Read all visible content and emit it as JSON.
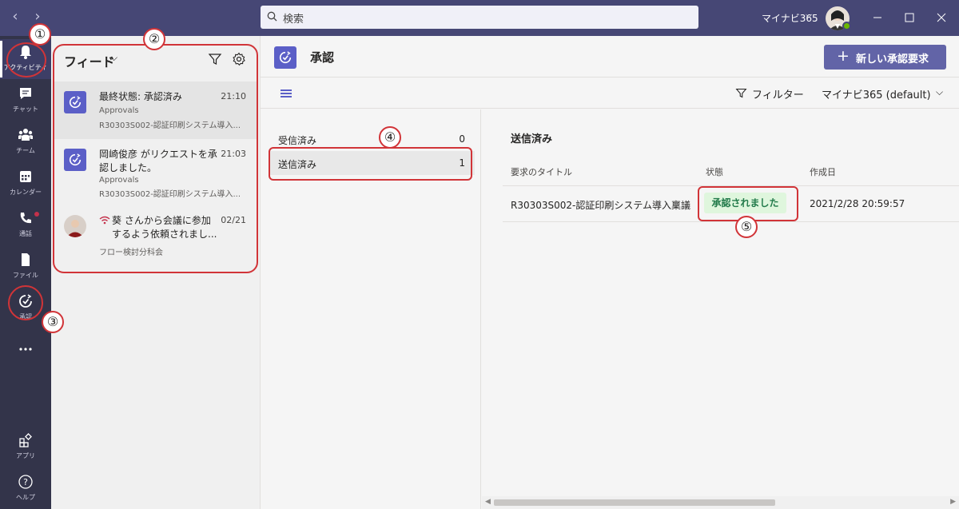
{
  "titlebar": {
    "search_placeholder": "検索",
    "org_name": "マイナビ365"
  },
  "rail": {
    "items": [
      {
        "label": "アクティビティ",
        "icon": "bell-icon"
      },
      {
        "label": "チャット",
        "icon": "chat-icon"
      },
      {
        "label": "チーム",
        "icon": "teams-icon"
      },
      {
        "label": "カレンダー",
        "icon": "calendar-icon"
      },
      {
        "label": "通話",
        "icon": "phone-icon"
      },
      {
        "label": "ファイル",
        "icon": "file-icon"
      },
      {
        "label": "承認",
        "icon": "approvals-icon"
      },
      {
        "label": "アプリ",
        "icon": "apps-icon"
      },
      {
        "label": "ヘルプ",
        "icon": "help-icon"
      }
    ]
  },
  "feed": {
    "title": "フィード",
    "items": [
      {
        "title": "最終状態: 承認済み",
        "time": "21:10",
        "app": "Approvals",
        "detail": "R30303S002-認証印刷システム導入..."
      },
      {
        "title": "岡崎俊彦 がリクエストを承認しました。",
        "time": "21:03",
        "app": "Approvals",
        "detail": "R30303S002-認証印刷システム導入..."
      },
      {
        "title": "葵 さんから会議に参加するよう依頼されまし...",
        "time": "02/21",
        "detail": "フロー検討分科会"
      }
    ]
  },
  "header": {
    "title": "承認",
    "new_request": "新しい承認要求"
  },
  "toolbar": {
    "filter": "フィルター",
    "environment": "マイナビ365 (default)"
  },
  "lists": [
    {
      "label": "受信済み",
      "count": "0"
    },
    {
      "label": "送信済み",
      "count": "1"
    }
  ],
  "detail": {
    "section_title": "送信済み",
    "columns": [
      "要求のタイトル",
      "状態",
      "作成日"
    ],
    "row": {
      "title": "R30303S002-認証印刷システム導入稟議",
      "status": "承認されました",
      "created": "2021/2/28 20:59:57"
    }
  },
  "annotations": [
    "①",
    "②",
    "③",
    "④",
    "⑤"
  ],
  "colors": {
    "titlebar": "#464775",
    "rail": "#33344a",
    "accent": "#6264a7",
    "annotation": "#d13438",
    "status_bg": "#dff6dd",
    "status_text": "#237b4b"
  }
}
